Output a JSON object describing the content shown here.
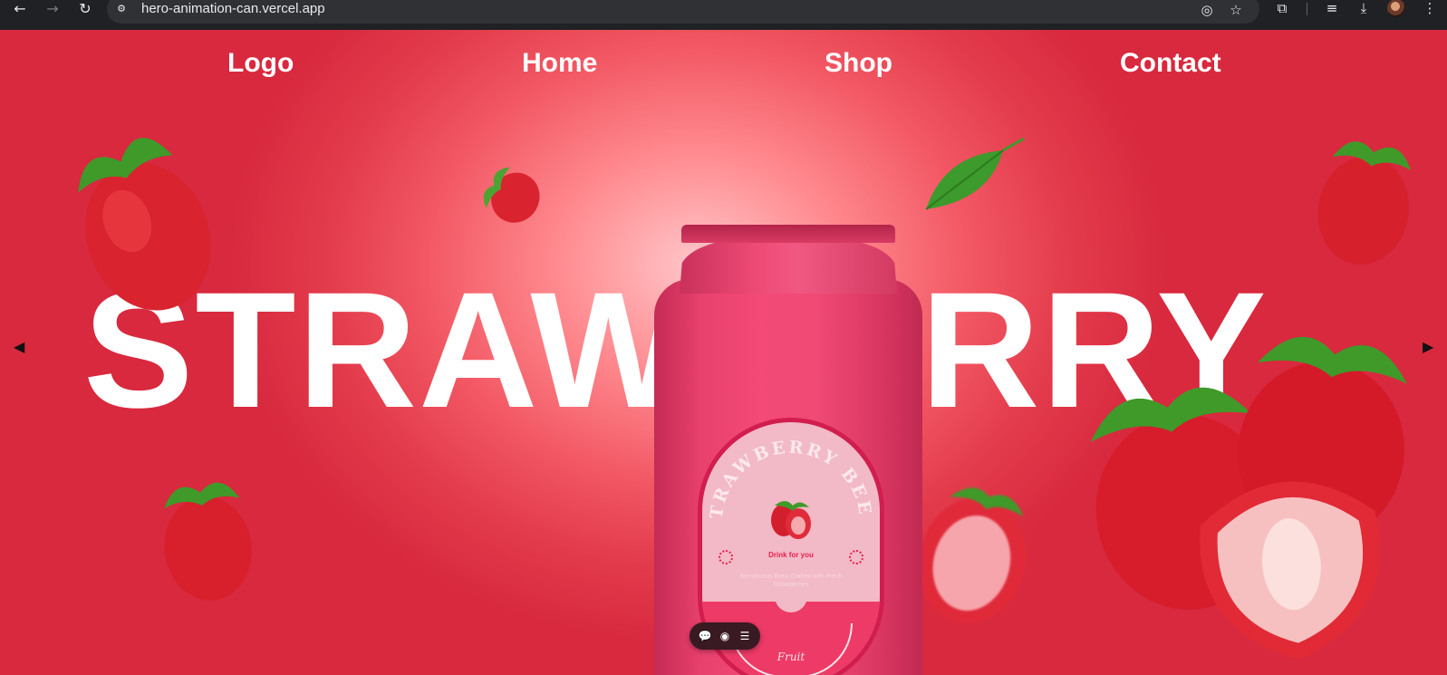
{
  "browser": {
    "url": "hero-animation-can.vercel.app",
    "icons": [
      "back-icon",
      "forward-icon",
      "reload-icon",
      "site-info-icon",
      "eye-off-icon",
      "star-icon",
      "extensions-icon",
      "reading-list-icon",
      "download-icon",
      "profile-avatar",
      "more-menu-icon"
    ]
  },
  "nav": {
    "logo": "Logo",
    "home": "Home",
    "shop": "Shop",
    "contact": "Contact"
  },
  "hero": {
    "word": "STRAWBERRY",
    "prev_arrow": "◀",
    "next_arrow": "▶"
  },
  "can": {
    "brand": "STRAWBERRY BEER",
    "tagline": "Drink for you",
    "description": "Berrylicious Brew Crafted with Fresh Strawberries",
    "flavor": "Fruit"
  },
  "colors": {
    "background_center": "#ffc6c9",
    "background_edge": "#d8293e",
    "can_body": "#f04a75",
    "label": "#f2b9c6",
    "text": "#ffffff"
  }
}
